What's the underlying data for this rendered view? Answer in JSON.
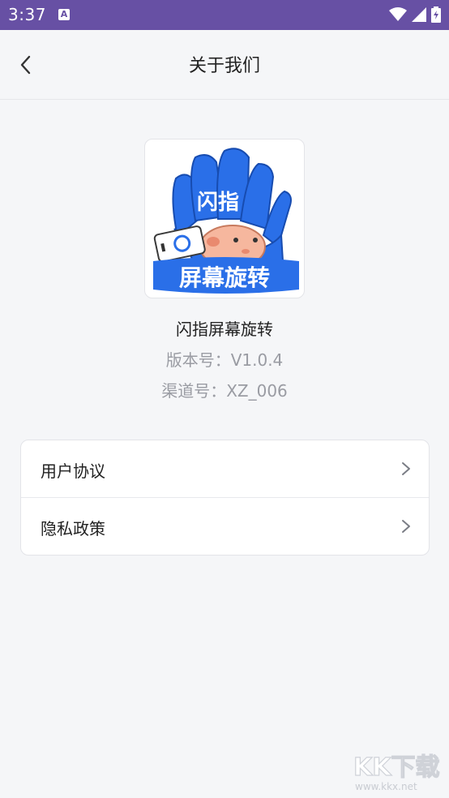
{
  "status_bar": {
    "time": "3:37",
    "notif_letter": "A"
  },
  "header": {
    "title": "关于我们"
  },
  "app": {
    "logo_top_text": "闪指",
    "logo_bottom_text": "屏幕旋转",
    "name": "闪指屏幕旋转",
    "version": "版本号：V1.0.4",
    "channel": "渠道号：XZ_006"
  },
  "menu": {
    "items": [
      {
        "label": "用户协议",
        "icon": "chevron-right-icon"
      },
      {
        "label": "隐私政策",
        "icon": "chevron-right-icon"
      }
    ]
  },
  "watermark": {
    "brand": "KK下载",
    "url": "www.kkx.net"
  },
  "colors": {
    "status_bar": "#6750a4",
    "background": "#f5f6f8",
    "logo_blue": "#2a6fe8"
  }
}
